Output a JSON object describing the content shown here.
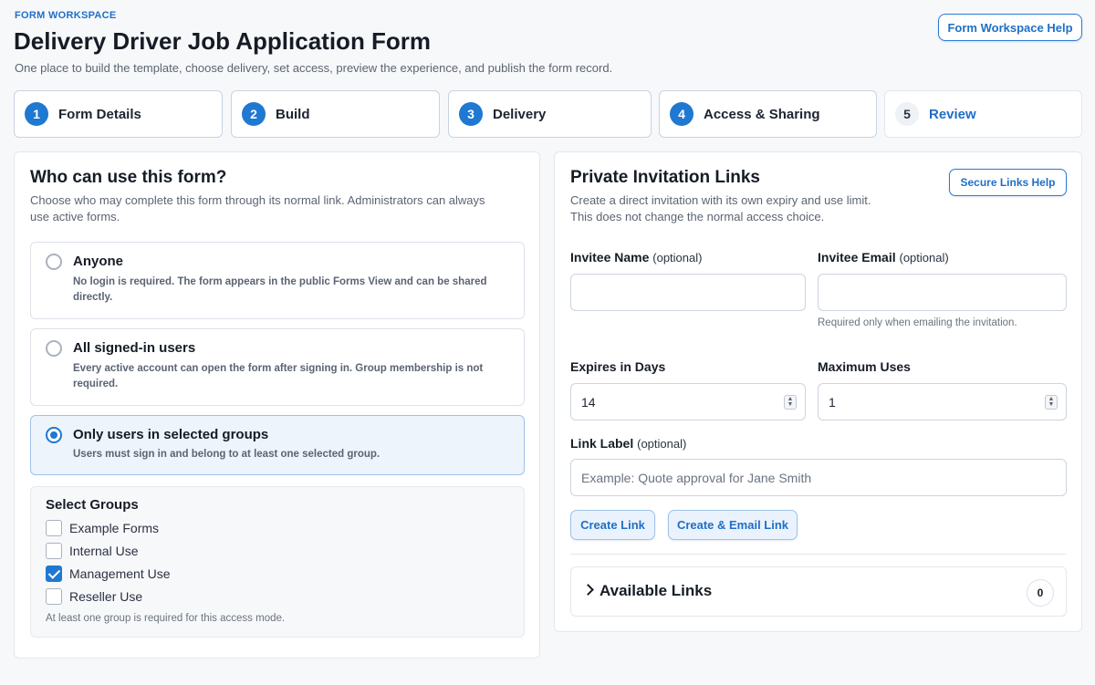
{
  "header": {
    "eyebrow": "FORM WORKSPACE",
    "title": "Delivery Driver Job Application Form",
    "subtitle": "One place to build the template, choose delivery, set access, preview the experience, and publish the form record.",
    "help_button": "Form Workspace Help"
  },
  "steps": [
    {
      "number": "1",
      "label": "Form Details"
    },
    {
      "number": "2",
      "label": "Build"
    },
    {
      "number": "3",
      "label": "Delivery"
    },
    {
      "number": "4",
      "label": "Access & Sharing"
    },
    {
      "number": "5",
      "label": "Review"
    }
  ],
  "access": {
    "title": "Who can use this form?",
    "description": "Choose who may complete this form through its normal link. Administrators can always use active forms.",
    "options": [
      {
        "title": "Anyone",
        "description": "No login is required. The form appears in the public Forms View and can be shared directly.",
        "selected": false
      },
      {
        "title": "All signed-in users",
        "description": "Every active account can open the form after signing in. Group membership is not required.",
        "selected": false
      },
      {
        "title": "Only users in selected groups",
        "description": "Users must sign in and belong to at least one selected group.",
        "selected": true
      }
    ],
    "groups": {
      "title": "Select Groups",
      "items": [
        {
          "label": "Example Forms",
          "checked": false
        },
        {
          "label": "Internal Use",
          "checked": false
        },
        {
          "label": "Management Use",
          "checked": true
        },
        {
          "label": "Reseller Use",
          "checked": false
        }
      ],
      "note": "At least one group is required for this access mode."
    }
  },
  "invitations": {
    "title": "Private Invitation Links",
    "description_line1": "Create a direct invitation with its own expiry and use limit.",
    "description_line2": "This does not change the normal access choice.",
    "help_button": "Secure Links Help",
    "invitee_name_label": "Invitee Name",
    "invitee_email_label": "Invitee Email",
    "optional_tag": "(optional)",
    "invitee_name_value": "",
    "invitee_email_value": "",
    "email_hint": "Required only when emailing the invitation.",
    "expires_label": "Expires in Days",
    "expires_value": "14",
    "max_uses_label": "Maximum Uses",
    "max_uses_value": "1",
    "link_label": "Link Label",
    "link_label_placeholder": "Example: Quote approval for Jane Smith",
    "create_button": "Create Link",
    "create_email_button": "Create & Email Link",
    "available_title": "Available Links",
    "available_count": "0"
  },
  "colors": {
    "accent": "#1f78d1",
    "accent_text": "#1f6fc7",
    "selected_bg": "#edf4fc"
  }
}
